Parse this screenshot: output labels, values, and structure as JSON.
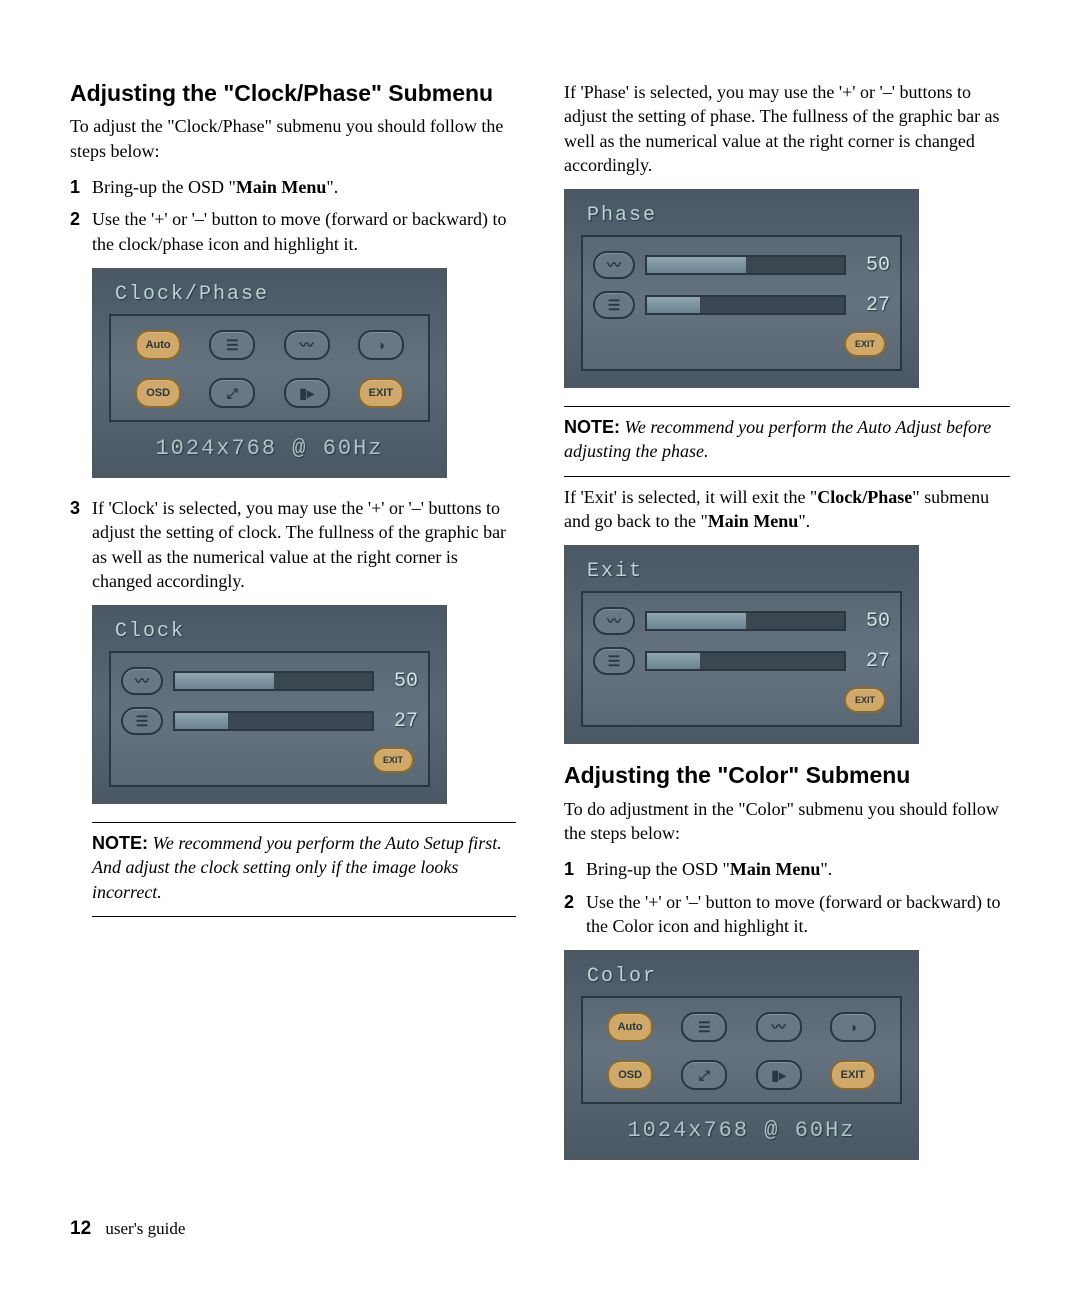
{
  "section1": {
    "heading": "Adjusting the \"Clock/Phase\" Submenu",
    "intro": "To adjust the \"Clock/Phase\" submenu you should follow the steps below:",
    "step1_a": "Bring-up the OSD \"",
    "step1_b": "Main Menu",
    "step1_c": "\".",
    "step2": "Use the '+' or '–' button to move (forward or backward) to the clock/phase icon and highlight it.",
    "step3": "If 'Clock' is selected, you may use the '+' or '–' buttons to adjust the setting of clock. The fullness of the graphic bar as well as the numerical value at the right corner is changed accordingly."
  },
  "osd_main": {
    "title": "Clock/Phase",
    "resolution": "1024x768 @ 60Hz",
    "icons_row1": [
      "Auto",
      "list",
      "wave",
      "color"
    ],
    "icons_row2": [
      "OSD",
      "expand",
      "info",
      "EXIT"
    ]
  },
  "osd_clock": {
    "title": "Clock",
    "val1": "50",
    "val2": "27",
    "exit": "EXIT"
  },
  "note1": {
    "label": "NOTE:",
    "text": " We recommend you perform the Auto Setup first. And adjust the clock setting only if the image looks incorrect."
  },
  "right_intro": "If 'Phase' is selected, you may use the '+' or '–' buttons to adjust the setting of phase. The fullness of the graphic bar as well as the numerical value at the right corner is changed accordingly.",
  "osd_phase": {
    "title": "Phase",
    "val1": "50",
    "val2": "27",
    "exit": "EXIT"
  },
  "note2": {
    "label": "NOTE:",
    "text": " We recommend you perform the Auto Adjust before adjusting the phase."
  },
  "exit_para_a": "If 'Exit' is selected, it will exit the \"",
  "exit_para_b": "Clock/Phase",
  "exit_para_c": "\" submenu and go back to the \"",
  "exit_para_d": "Main Menu",
  "exit_para_e": "\".",
  "osd_exit": {
    "title": "Exit",
    "val1": "50",
    "val2": "27",
    "exit": "EXIT"
  },
  "section2": {
    "heading": "Adjusting the \"Color\" Submenu",
    "intro": "To do adjustment in the \"Color\" submenu you should follow the steps below:",
    "step1_a": "Bring-up the OSD \"",
    "step1_b": "Main Menu",
    "step1_c": "\".",
    "step2": "Use the '+' or '–' button to move (forward or backward) to the Color icon and highlight it."
  },
  "osd_color": {
    "title": "Color",
    "resolution": "1024x768 @ 60Hz"
  },
  "footer": {
    "page": "12",
    "label": "user's guide"
  }
}
